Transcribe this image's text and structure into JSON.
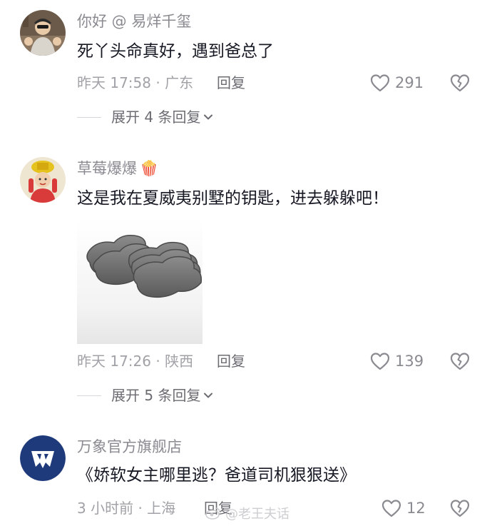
{
  "comments": [
    {
      "username": "你好 @ 易烊千玺",
      "text": "死丫头命真好，遇到爸总了",
      "time_location": "昨天 17:58 · 广东",
      "reply_label": "回复",
      "likes": "291",
      "expand_label": "展开 4 条回复"
    },
    {
      "username": "草莓爆爆",
      "username_emoji": "🍿",
      "text": "这是我在夏威夷别墅的钥匙，进去躲躲吧！",
      "time_location": "昨天 17:26 · 陕西",
      "reply_label": "回复",
      "likes": "139",
      "expand_label": "展开 5 条回复"
    },
    {
      "username": "万象官方旗舰店",
      "text": "《娇软女主哪里逃？爸道司机狠狠送》",
      "time_location": "3 小时前 · 上海",
      "reply_label": "回复",
      "likes": "12"
    }
  ],
  "watermark": "@老王夫话",
  "icons": {
    "like": "heart-outline-icon",
    "dislike": "broken-heart-icon",
    "expand": "chevron-down-icon"
  },
  "colors": {
    "text_primary": "#161823",
    "text_secondary": "#8a8b91",
    "brand_avatar": "#1f3a7a"
  }
}
